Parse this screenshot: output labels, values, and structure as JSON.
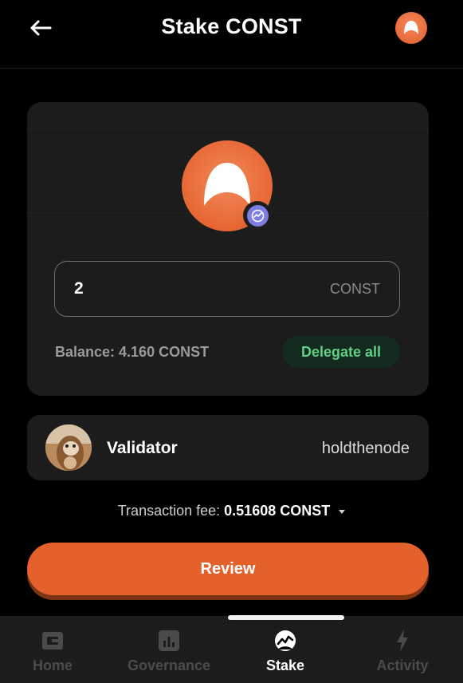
{
  "header": {
    "title": "Stake CONST"
  },
  "stake": {
    "amount": "2",
    "unit": "CONST",
    "balance": "Balance: 4.160 CONST",
    "delegate_all": "Delegate all"
  },
  "validator": {
    "label": "Validator",
    "name": "holdthenode"
  },
  "fee": {
    "label": "Transaction fee:",
    "value": "0.51608 CONST"
  },
  "review_label": "Review",
  "nav": {
    "items": [
      {
        "label": "Home",
        "icon": "wallet-icon"
      },
      {
        "label": "Governance",
        "icon": "governance-chart-icon"
      },
      {
        "label": "Stake",
        "icon": "stake-icon",
        "active": true
      },
      {
        "label": "Activity",
        "icon": "lightning-icon"
      }
    ]
  },
  "colors": {
    "accent": "#e4612c",
    "delegate_text": "#5fcf84",
    "badge": "#7c7ee4"
  }
}
